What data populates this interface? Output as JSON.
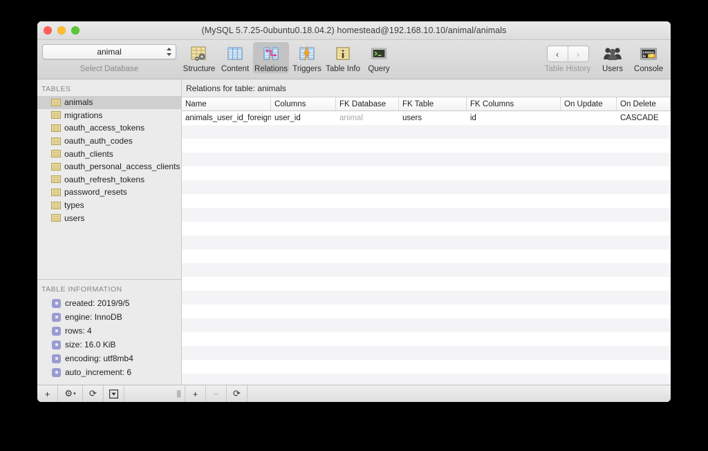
{
  "window": {
    "title": "(MySQL 5.7.25-0ubuntu0.18.04.2) homestead@192.168.10.10/animal/animals",
    "traffic_lights": [
      "close",
      "minimize",
      "maximize"
    ]
  },
  "toolbar": {
    "database_select": {
      "value": "animal",
      "caption": "Select Database"
    },
    "items": [
      {
        "label": "Structure",
        "icon": "structure-icon",
        "active": false
      },
      {
        "label": "Content",
        "icon": "content-icon",
        "active": false
      },
      {
        "label": "Relations",
        "icon": "relations-icon",
        "active": true
      },
      {
        "label": "Triggers",
        "icon": "triggers-icon",
        "active": false
      },
      {
        "label": "Table Info",
        "icon": "table-info-icon",
        "active": false
      },
      {
        "label": "Query",
        "icon": "query-icon",
        "active": false
      }
    ],
    "right_items": [
      {
        "label": "Table History",
        "icon": "history-nav",
        "dim": true
      },
      {
        "label": "Users",
        "icon": "users-icon",
        "dim": false
      },
      {
        "label": "Console",
        "icon": "console-icon",
        "dim": false
      }
    ],
    "nav_back": "‹",
    "nav_forward": "›"
  },
  "sidebar": {
    "tables_header": "TABLES",
    "tables": [
      {
        "name": "animals",
        "selected": true
      },
      {
        "name": "migrations",
        "selected": false
      },
      {
        "name": "oauth_access_tokens",
        "selected": false
      },
      {
        "name": "oauth_auth_codes",
        "selected": false
      },
      {
        "name": "oauth_clients",
        "selected": false
      },
      {
        "name": "oauth_personal_access_clients",
        "selected": false
      },
      {
        "name": "oauth_refresh_tokens",
        "selected": false
      },
      {
        "name": "password_resets",
        "selected": false
      },
      {
        "name": "types",
        "selected": false
      },
      {
        "name": "users",
        "selected": false
      }
    ],
    "info_header": "TABLE INFORMATION",
    "info_rows": [
      "created: 2019/9/5",
      "engine: InnoDB",
      "rows: 4",
      "size: 16.0 KiB",
      "encoding: utf8mb4",
      "auto_increment: 6"
    ]
  },
  "main": {
    "header": "Relations for table: animals",
    "columns": [
      "Name",
      "Columns",
      "FK Database",
      "FK Table",
      "FK Columns",
      "On Update",
      "On Delete"
    ],
    "rows": [
      {
        "Name": "animals_user_id_foreign",
        "Columns": "user_id",
        "FK Database": "animal",
        "FK Table": "users",
        "FK Columns": "id",
        "On Update": "",
        "On Delete": "CASCADE"
      }
    ],
    "empty_row_count": 19
  },
  "bottombar": {
    "left_buttons": [
      {
        "icon": "plus-icon",
        "label": "+",
        "dim": false
      },
      {
        "icon": "gear-icon",
        "label": "⚙",
        "dim": false
      },
      {
        "icon": "refresh-icon",
        "label": "⟳",
        "dim": false
      },
      {
        "icon": "export-icon",
        "label": "▾",
        "dim": false
      }
    ],
    "resize_grip": "|||",
    "right_buttons": [
      {
        "icon": "add-relation-icon",
        "label": "+",
        "dim": false
      },
      {
        "icon": "remove-relation-icon",
        "label": "−",
        "dim": true
      },
      {
        "icon": "reload-relation-icon",
        "label": "⟳",
        "dim": false
      }
    ]
  },
  "colors": {
    "accent_selected": "#cfcfcf",
    "table_icon": "#e8d79a",
    "info_bullet": "#9a9bd0",
    "stripe_even": "#f4f4f6",
    "stripe_odd": "#ffffff"
  }
}
